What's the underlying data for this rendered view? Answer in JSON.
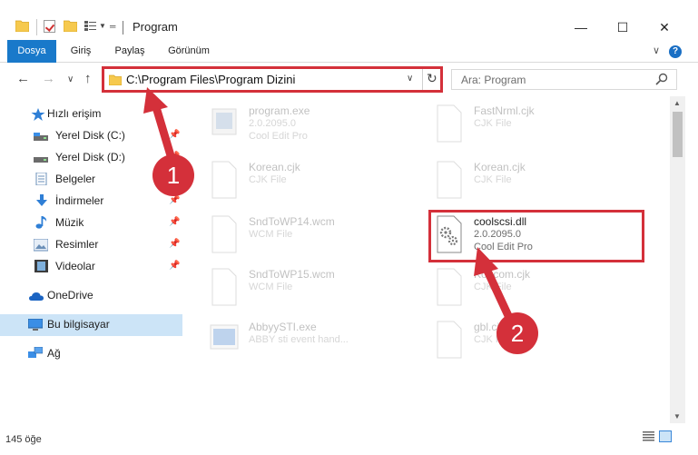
{
  "window": {
    "title": "Program",
    "minimize_glyph": "—",
    "maximize_glyph": "☐",
    "close_glyph": "✕"
  },
  "ribbon": {
    "tabs": [
      {
        "label": "Dosya",
        "active": true
      },
      {
        "label": "Giriş",
        "active": false
      },
      {
        "label": "Paylaş",
        "active": false
      },
      {
        "label": "Görünüm",
        "active": false
      }
    ],
    "help_glyph": "?",
    "collapse_glyph": "∨"
  },
  "nav": {
    "back_glyph": "←",
    "forward_glyph": "→",
    "recent_glyph": "∨",
    "up_glyph": "↑",
    "address": "C:\\Program Files\\Program Dizini",
    "address_caret": "∨",
    "refresh_glyph": "↻",
    "search_placeholder": "Ara: Program"
  },
  "sidebar": {
    "items": [
      {
        "label": "Hızlı erişim",
        "icon": "star-icon",
        "pinned": false
      },
      {
        "label": "Yerel Disk (C:)",
        "icon": "drive-icon",
        "pinned": true
      },
      {
        "label": "Yerel Disk (D:)",
        "icon": "drive-icon",
        "pinned": true
      },
      {
        "label": "Belgeler",
        "icon": "documents-icon",
        "pinned": true
      },
      {
        "label": "İndirmeler",
        "icon": "download-icon",
        "pinned": true
      },
      {
        "label": "Müzik",
        "icon": "music-icon",
        "pinned": true
      },
      {
        "label": "Resimler",
        "icon": "pictures-icon",
        "pinned": true
      },
      {
        "label": "Videolar",
        "icon": "video-icon",
        "pinned": true
      },
      {
        "label": "OneDrive",
        "icon": "cloud-icon",
        "pinned": false
      },
      {
        "label": "Bu bilgisayar",
        "icon": "computer-icon",
        "pinned": false,
        "selected": true
      },
      {
        "label": "Ağ",
        "icon": "network-icon",
        "pinned": false
      }
    ],
    "pin_glyph": "📌"
  },
  "files": [
    {
      "name": "program.exe",
      "line2": "2.0.2095.0",
      "line3": "Cool Edit Pro",
      "icon": "exe-icon",
      "faded": true
    },
    {
      "name": "FastNrml.cjk",
      "line2": "CJK File",
      "line3": "",
      "icon": "file-icon",
      "faded": true
    },
    {
      "name": "Korean.cjk",
      "line2": "CJK File",
      "line3": "",
      "icon": "file-icon",
      "faded": true
    },
    {
      "name": "Korean.cjk",
      "line2": "CJK File",
      "line3": "",
      "icon": "file-icon",
      "faded": true
    },
    {
      "name": "SndToWP14.wcm",
      "line2": "WCM File",
      "line3": "",
      "icon": "file-icon",
      "faded": true
    },
    {
      "name": "coolscsi.dll",
      "line2": "2.0.2095.0",
      "line3": "Cool Edit Pro",
      "icon": "dll-icon",
      "faded": false
    },
    {
      "name": "SndToWP15.wcm",
      "line2": "WCM File",
      "line3": "",
      "icon": "file-icon",
      "faded": true
    },
    {
      "name": "Kor.com.cjk",
      "line2": "CJK File",
      "line3": "",
      "icon": "file-icon",
      "faded": true
    },
    {
      "name": "AbbyySTI.exe",
      "line2": "ABBY sti event hand...",
      "line3": "",
      "icon": "exe-icon",
      "faded": true
    },
    {
      "name": "gbl.cjk",
      "line2": "CJK File",
      "line3": "",
      "icon": "file-icon",
      "faded": true
    }
  ],
  "callouts": [
    {
      "number": "1"
    },
    {
      "number": "2"
    }
  ],
  "status": {
    "item_count": "145 öğe"
  },
  "colors": {
    "accent": "#1979ca",
    "callout_red": "#d4303a",
    "selection": "#cce4f7"
  }
}
